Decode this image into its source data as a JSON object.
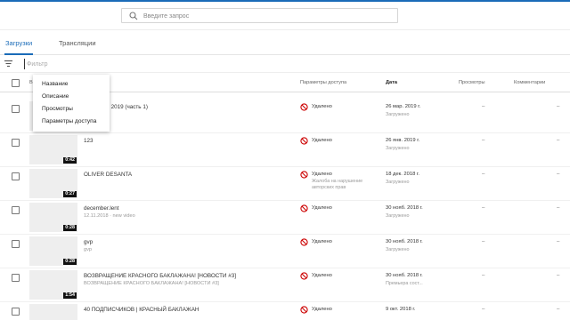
{
  "colors": {
    "accent": "#1a6bb8",
    "no_icon": "#cc0000"
  },
  "search": {
    "placeholder": "Введите запрос"
  },
  "tabs": [
    {
      "label": "Загрузки",
      "active": true
    },
    {
      "label": "Трансляции",
      "active": false
    }
  ],
  "filter": {
    "placeholder": "Фильтр"
  },
  "table": {
    "headers": {
      "video": "В",
      "access": "Параметры доступа",
      "date": "Дата",
      "views": "Просмотры",
      "comments": "Комментарии"
    },
    "rows": [
      {
        "duration": "",
        "title": "мий 26 03 2019 (часть 1)",
        "desc": "",
        "access": "Удалено",
        "access_sub": "",
        "date": "26 мар. 2019 г.",
        "date_sub": "Загружено",
        "views": "–",
        "comments": "–"
      },
      {
        "duration": "0:42",
        "title": "123",
        "desc": "",
        "access": "Удалено",
        "access_sub": "",
        "date": "26 янв. 2019 г.",
        "date_sub": "Загружено",
        "views": "–",
        "comments": "–"
      },
      {
        "duration": "0:27",
        "title": "OLIVER DESANTA",
        "desc": "",
        "access": "Удалено",
        "access_sub": "Жалоба на нарушение авторских прав",
        "date": "18 дек. 2018 г.",
        "date_sub": "Загружено",
        "views": "–",
        "comments": "–"
      },
      {
        "duration": "0:28",
        "title": "december.lent",
        "desc": "12.11.2018 · new video",
        "access": "Удалено",
        "access_sub": "",
        "date": "30 нояб. 2018 г.",
        "date_sub": "Загружено",
        "views": "–",
        "comments": "–"
      },
      {
        "duration": "0:28",
        "title": "gvp",
        "desc": "gvp",
        "access": "Удалено",
        "access_sub": "",
        "date": "30 нояб. 2018 г.",
        "date_sub": "Загружено",
        "views": "–",
        "comments": "–"
      },
      {
        "duration": "1:54",
        "title": "ВОЗВРАЩЕНИЕ КРАСНОГО БАКЛАЖАНА! [НОВОСТИ #3]",
        "desc": "ВОЗВРАЩЕНИЕ КРАСНОГО БАКЛАЖАНА! [НОВОСТИ #3]",
        "access": "Удалено",
        "access_sub": "",
        "date": "30 нояб. 2018 г.",
        "date_sub": "Премьера сост...",
        "views": "–",
        "comments": "–"
      },
      {
        "duration": "",
        "title": "40 ПОДПИСЧИКОВ | КРАСНЫЙ БАКЛАЖАН",
        "desc": "",
        "access": "Удалено",
        "access_sub": "",
        "date": "9 окт. 2018 г.",
        "date_sub": "",
        "views": "–",
        "comments": "–"
      }
    ]
  },
  "menu": {
    "items": [
      "Название",
      "Описание",
      "Просмотры",
      "Параметры доступа"
    ]
  }
}
